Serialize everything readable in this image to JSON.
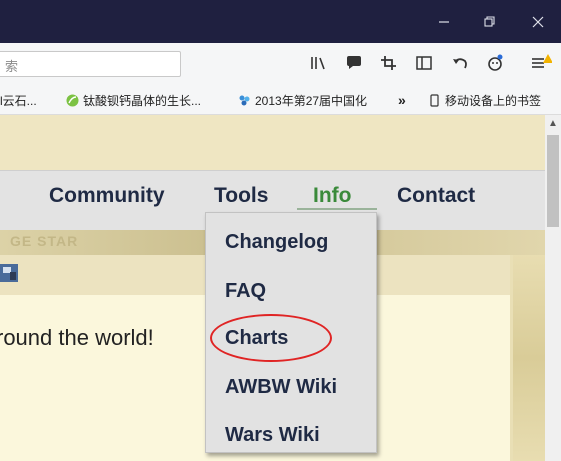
{
  "toolbar": {
    "search_placeholder": "索"
  },
  "bookmarks": [
    {
      "label": "l云石...",
      "icon": "none"
    },
    {
      "label": "钛酸钡钙晶体的生长...",
      "icon": "leaf-icon"
    },
    {
      "label": "2013年第27届中国化",
      "icon": "sparkle-icon"
    },
    {
      "label": "»",
      "icon": "none"
    },
    {
      "label": "移动设备上的书签",
      "icon": "mobile-icon"
    }
  ],
  "nav": {
    "items": [
      "Community",
      "Tools",
      "Info",
      "Contact"
    ],
    "active": "Info"
  },
  "page": {
    "decor_text": "GE STAR",
    "greeting": "round the world!"
  },
  "dropdown": {
    "items": [
      "Changelog",
      "FAQ",
      "Charts",
      "AWBW Wiki",
      "Wars Wiki"
    ],
    "highlighted": "Charts"
  },
  "colors": {
    "titlebar": "#1f2040",
    "nav_active": "#3a8a3a",
    "highlight": "#e02424"
  }
}
